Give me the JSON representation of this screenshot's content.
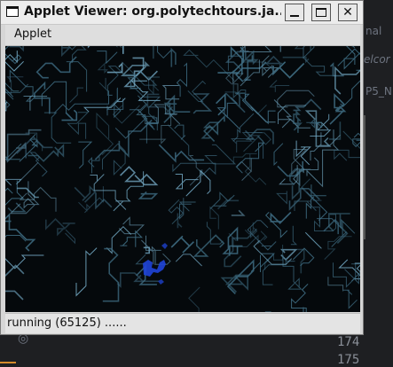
{
  "window": {
    "title": "Applet Viewer: org.polytechtours.ja...",
    "minimize_icon": "minimize-icon",
    "maximize_icon": "maximize-icon",
    "close_icon": "close-icon"
  },
  "menu": {
    "applet_label": "Applet"
  },
  "status": {
    "text": "running (65125) ......"
  },
  "background_editor": {
    "fragments": [
      "nal",
      "elcor",
      "P5_N"
    ],
    "line_numbers": [
      "174",
      "175"
    ]
  },
  "colors": {
    "canvas_bg": "#05090c",
    "trace": "#3d6a80",
    "trace_bright": "#6fa3bd",
    "blue_blob": "#1f44d8"
  }
}
